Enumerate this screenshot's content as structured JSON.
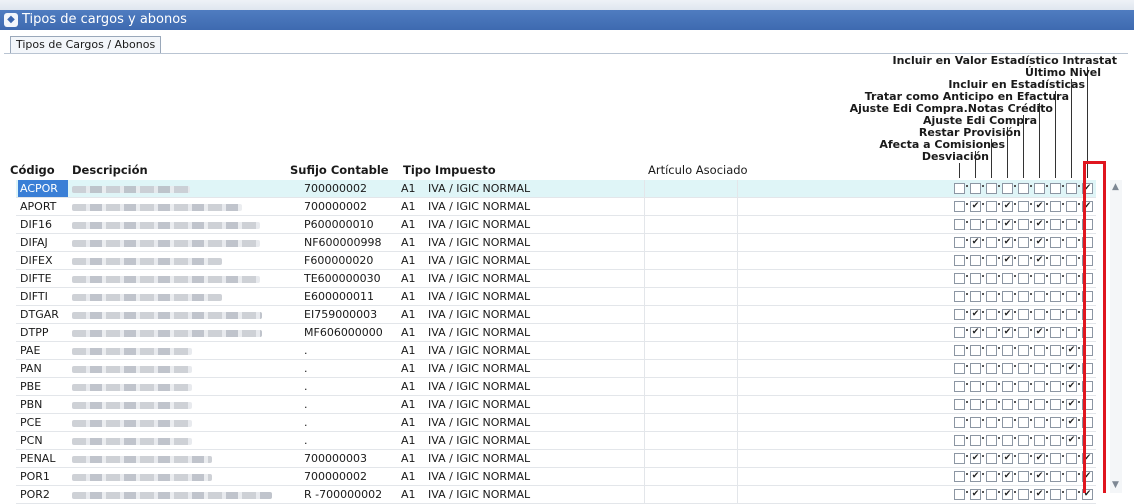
{
  "window": {
    "title": "Tipos de cargos y abonos"
  },
  "tab": {
    "label": "Tipos de Cargos / Abonos"
  },
  "columns": {
    "codigo": "Código",
    "descripcion": "Descripción",
    "sufijo": "Sufijo Contable",
    "tipo": "Tipo Impuesto",
    "articulo": "Artículo Asociado"
  },
  "check_headers": [
    "Incluir en Valor Estadístico Intrastat",
    "Último Nivel",
    "Incluir en Estadísticas",
    "Tratar como Anticipo en Efactura",
    "Ajuste Edi Compra.Notas Crédito",
    "Ajuste Edi Compra",
    "Restar Provisión",
    "Afecta a Comisiones",
    "Desviación"
  ],
  "rows": [
    {
      "code": "ACPOR",
      "sufijo": "700000002",
      "tipo": "A1",
      "impuesto": "IVA / IGIC NORMAL",
      "checks": [
        0,
        0,
        0,
        0,
        0,
        0,
        0,
        0,
        1
      ],
      "selected": true
    },
    {
      "code": "APORT",
      "sufijo": "700000002",
      "tipo": "A1",
      "impuesto": "IVA / IGIC NORMAL",
      "checks": [
        0,
        1,
        0,
        1,
        0,
        1,
        0,
        0,
        1
      ]
    },
    {
      "code": "DIF16",
      "sufijo": "P600000010",
      "tipo": "A1",
      "impuesto": "IVA / IGIC NORMAL",
      "checks": [
        0,
        0,
        0,
        1,
        0,
        1,
        0,
        0,
        0
      ]
    },
    {
      "code": "DIFAJ",
      "sufijo": "NF600000998",
      "tipo": "A1",
      "impuesto": "IVA / IGIC NORMAL",
      "checks": [
        0,
        1,
        0,
        1,
        0,
        1,
        0,
        0,
        0
      ]
    },
    {
      "code": "DIFEX",
      "sufijo": "F600000020",
      "tipo": "A1",
      "impuesto": "IVA / IGIC NORMAL",
      "checks": [
        0,
        0,
        0,
        1,
        0,
        1,
        0,
        0,
        0
      ]
    },
    {
      "code": "DIFTE",
      "sufijo": "TE600000030",
      "tipo": "A1",
      "impuesto": "IVA / IGIC NORMAL",
      "checks": [
        0,
        0,
        0,
        0,
        0,
        0,
        0,
        0,
        0
      ]
    },
    {
      "code": "DIFTI",
      "sufijo": "E600000011",
      "tipo": "A1",
      "impuesto": "IVA / IGIC NORMAL",
      "checks": [
        0,
        0,
        0,
        0,
        0,
        0,
        0,
        0,
        0
      ]
    },
    {
      "code": "DTGAR",
      "sufijo": "EI759000003",
      "tipo": "A1",
      "impuesto": "IVA / IGIC NORMAL",
      "checks": [
        0,
        1,
        0,
        1,
        0,
        0,
        0,
        0,
        0
      ]
    },
    {
      "code": "DTPP",
      "sufijo": "MF606000000",
      "tipo": "A1",
      "impuesto": "IVA / IGIC NORMAL",
      "checks": [
        0,
        1,
        0,
        1,
        0,
        1,
        0,
        0,
        0
      ]
    },
    {
      "code": "PAE",
      "sufijo": ".",
      "tipo": "A1",
      "impuesto": "IVA / IGIC NORMAL",
      "checks": [
        0,
        0,
        0,
        0,
        0,
        0,
        0,
        1,
        0
      ]
    },
    {
      "code": "PAN",
      "sufijo": ".",
      "tipo": "A1",
      "impuesto": "IVA / IGIC NORMAL",
      "checks": [
        0,
        0,
        0,
        0,
        0,
        0,
        0,
        1,
        0
      ]
    },
    {
      "code": "PBE",
      "sufijo": ".",
      "tipo": "A1",
      "impuesto": "IVA / IGIC NORMAL",
      "checks": [
        0,
        0,
        0,
        0,
        0,
        0,
        0,
        1,
        0
      ]
    },
    {
      "code": "PBN",
      "sufijo": ".",
      "tipo": "A1",
      "impuesto": "IVA / IGIC NORMAL",
      "checks": [
        0,
        0,
        0,
        0,
        0,
        0,
        0,
        1,
        0
      ]
    },
    {
      "code": "PCE",
      "sufijo": ".",
      "tipo": "A1",
      "impuesto": "IVA / IGIC NORMAL",
      "checks": [
        0,
        0,
        0,
        0,
        0,
        0,
        0,
        1,
        0
      ]
    },
    {
      "code": "PCN",
      "sufijo": ".",
      "tipo": "A1",
      "impuesto": "IVA / IGIC NORMAL",
      "checks": [
        0,
        0,
        0,
        0,
        0,
        0,
        0,
        1,
        0
      ]
    },
    {
      "code": "PENAL",
      "sufijo": "700000003",
      "tipo": "A1",
      "impuesto": "IVA / IGIC NORMAL",
      "checks": [
        0,
        1,
        0,
        1,
        0,
        1,
        0,
        0,
        1
      ]
    },
    {
      "code": "POR1",
      "sufijo": "700000002",
      "tipo": "A1",
      "impuesto": "IVA / IGIC NORMAL",
      "checks": [
        0,
        1,
        0,
        1,
        0,
        1,
        0,
        0,
        1
      ]
    },
    {
      "code": "POR2",
      "sufijo": "R -700000002",
      "tipo": "A1",
      "impuesto": "IVA / IGIC NORMAL",
      "checks": [
        0,
        1,
        0,
        1,
        0,
        1,
        0,
        0,
        1
      ]
    }
  ],
  "colors": {
    "titlebar": "#3e6ab0",
    "highlight": "#e0161f",
    "selected_row": "#dff5f7"
  },
  "icons": {
    "window": "app-icon",
    "scroll_up": "arrow-up-icon",
    "scroll_down": "arrow-down-icon"
  }
}
